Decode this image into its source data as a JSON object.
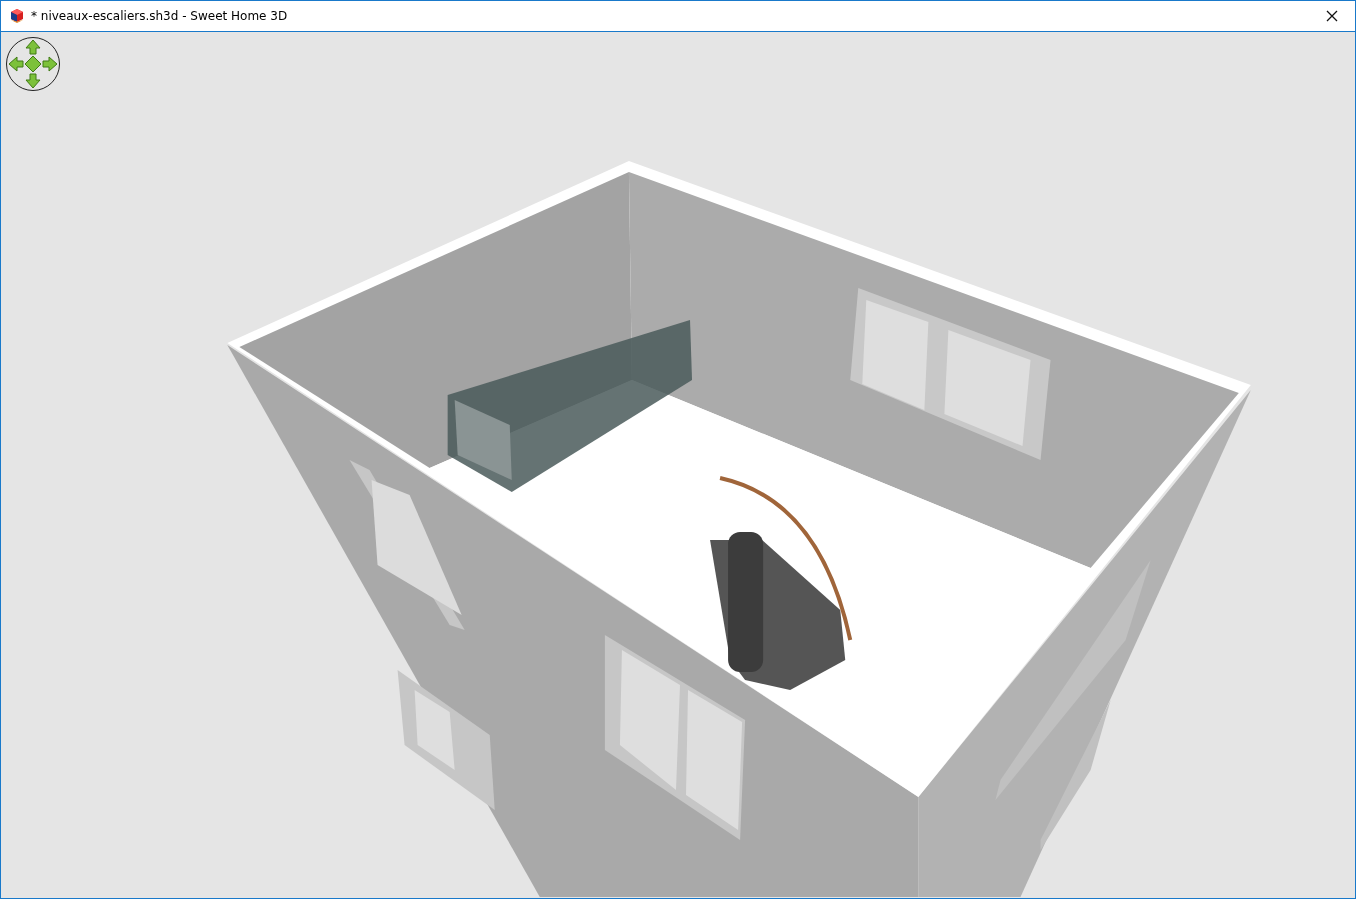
{
  "window": {
    "title": "* niveaux-escaliers.sh3d - Sweet Home 3D"
  }
}
